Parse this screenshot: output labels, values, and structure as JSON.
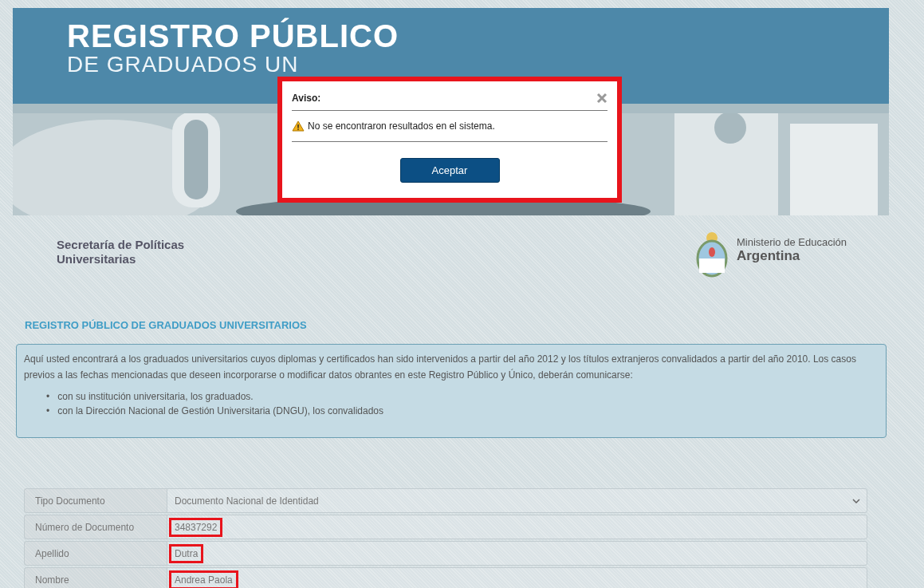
{
  "banner": {
    "title": "REGISTRO PÚBLICO",
    "subtitle": "DE GRADUADOS UN",
    "kind": "picture"
  },
  "dialog": {
    "title": "Aviso:",
    "message": "No se encontraron resultados en el sistema.",
    "button": "Aceptar",
    "highlighted": true
  },
  "logos": {
    "left": [
      "Secretaría de Políticas",
      "Universitarias"
    ],
    "right": {
      "line1": "Ministerio de Educación",
      "line2": "Argentina"
    }
  },
  "heading": "REGISTRO PÚBLICO DE GRADUADOS UNIVERSITARIOS",
  "info": {
    "paragraph": "Aquí usted encontrará a los graduados universitarios cuyos diplomas y certificados han sido intervenidos a partir del año 2012 y los títulos extranjeros convalidados a partir del año 2010. Los casos previos a las fechas mencionadas que deseen incorporarse o modificar datos obrantes en este Registro Público y Único, deberán comunicarse:",
    "bullets": [
      {
        "marker": "•",
        "text": "con su institución universitaria, los graduados."
      },
      {
        "marker": "•",
        "text": "con la Dirección Nacional de Gestión Universitaria (DNGU), los convalidados"
      }
    ]
  },
  "form": [
    {
      "kind": "select",
      "label": "Tipo Documento",
      "value": "Documento Nacional de Identidad",
      "highlighted": false
    },
    {
      "kind": "text",
      "label": "Número de Documento",
      "value": "34837292",
      "highlighted": true
    },
    {
      "kind": "text",
      "label": "Apellido",
      "value": "Dutra",
      "highlighted": true
    },
    {
      "kind": "text",
      "label": "Nombre",
      "value": "Andrea Paola",
      "highlighted": true
    }
  ]
}
